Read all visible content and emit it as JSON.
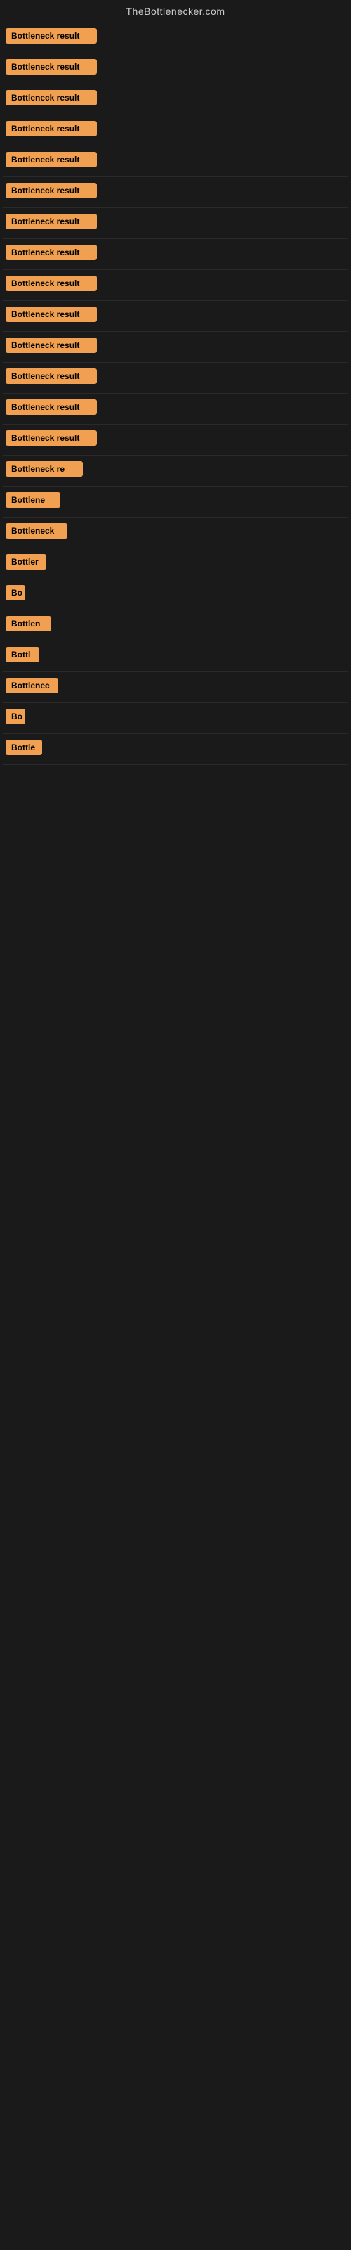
{
  "site": {
    "title": "TheBottlenecker.com"
  },
  "badges": [
    {
      "id": 1,
      "label": "Bottleneck result",
      "width": "full"
    },
    {
      "id": 2,
      "label": "Bottleneck result",
      "width": "full"
    },
    {
      "id": 3,
      "label": "Bottleneck result",
      "width": "full"
    },
    {
      "id": 4,
      "label": "Bottleneck result",
      "width": "full"
    },
    {
      "id": 5,
      "label": "Bottleneck result",
      "width": "full"
    },
    {
      "id": 6,
      "label": "Bottleneck result",
      "width": "full"
    },
    {
      "id": 7,
      "label": "Bottleneck result",
      "width": "full"
    },
    {
      "id": 8,
      "label": "Bottleneck result",
      "width": "full"
    },
    {
      "id": 9,
      "label": "Bottleneck result",
      "width": "full"
    },
    {
      "id": 10,
      "label": "Bottleneck result",
      "width": "full"
    },
    {
      "id": 11,
      "label": "Bottleneck result",
      "width": "full"
    },
    {
      "id": 12,
      "label": "Bottleneck result",
      "width": "full"
    },
    {
      "id": 13,
      "label": "Bottleneck result",
      "width": "full"
    },
    {
      "id": 14,
      "label": "Bottleneck result",
      "width": "full"
    },
    {
      "id": 15,
      "label": "Bottleneck re",
      "width": "partial"
    },
    {
      "id": 16,
      "label": "Bottlene",
      "width": "partial"
    },
    {
      "id": 17,
      "label": "Bottleneck",
      "width": "partial"
    },
    {
      "id": 18,
      "label": "Bottler",
      "width": "partial"
    },
    {
      "id": 19,
      "label": "Bo",
      "width": "partial"
    },
    {
      "id": 20,
      "label": "Bottlen",
      "width": "partial"
    },
    {
      "id": 21,
      "label": "Bottl",
      "width": "partial"
    },
    {
      "id": 22,
      "label": "Bottlenec",
      "width": "partial"
    },
    {
      "id": 23,
      "label": "Bo",
      "width": "partial"
    },
    {
      "id": 24,
      "label": "Bottle",
      "width": "partial"
    }
  ],
  "colors": {
    "badge_bg": "#f0a050",
    "badge_text": "#000000",
    "background": "#1a1a1a",
    "title_text": "#cccccc",
    "divider": "#2a2a2a"
  }
}
